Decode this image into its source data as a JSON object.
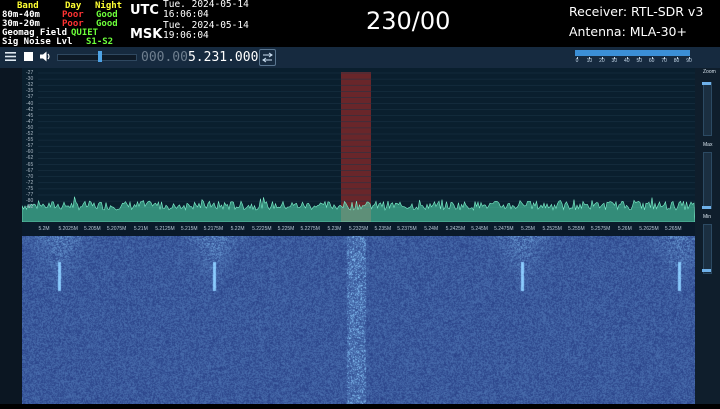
{
  "band_conditions": {
    "header": {
      "band": "Band",
      "day": "Day",
      "night": "Night"
    },
    "rows": [
      {
        "band": "80m-40m",
        "day": "Poor",
        "night": "Good"
      },
      {
        "band": "30m-20m",
        "day": "Poor",
        "night": "Good"
      }
    ],
    "geomag_label": "Geomag Field",
    "geomag_value": "QUIET",
    "noise_label": "Sig Noise Lvl",
    "noise_value": "S1-S2"
  },
  "clocks": [
    {
      "zone": "UTC",
      "date": "Tue. 2024-05-14",
      "time": "16:06:04"
    },
    {
      "zone": "MSK",
      "date": "Tue. 2024-05-14",
      "time": "19:06:04"
    }
  ],
  "big_frequency": "230/00",
  "receiver": {
    "label": "Receiver: RTL-SDR v3",
    "antenna": "Antenna: MLA-30+"
  },
  "toolbar": {
    "frequency_dim": "000.00",
    "frequency_value": "5.231.000",
    "swap_icon": "swap-arrows-icon",
    "zoom_scale": [
      "0",
      "10",
      "20",
      "30",
      "40",
      "50",
      "60",
      "70",
      "80",
      "90"
    ]
  },
  "spectrum": {
    "db_labels": [
      "-27",
      "-30",
      "-32",
      "-35",
      "-37",
      "-40",
      "-42",
      "-45",
      "-47",
      "-50",
      "-52",
      "-55",
      "-57",
      "-60",
      "-62",
      "-65",
      "-67",
      "-70",
      "-72",
      "-75",
      "-77",
      "-80",
      "-82"
    ],
    "freq_labels": [
      "5.2M",
      "5.2025M",
      "5.205M",
      "5.2075M",
      "5.21M",
      "5.2125M",
      "5.215M",
      "5.2175M",
      "5.22M",
      "5.2225M",
      "5.225M",
      "5.2275M",
      "5.23M",
      "5.2325M",
      "5.235M",
      "5.2375M",
      "5.24M",
      "5.2425M",
      "5.245M",
      "5.2475M",
      "5.25M",
      "5.2525M",
      "5.255M",
      "5.2575M",
      "5.26M",
      "5.2625M",
      "5.265M"
    ]
  },
  "right_panel": {
    "zoom": "Zoom",
    "max": "Max",
    "min": "Min"
  },
  "colors": {
    "accent": "#4ea3e6",
    "good": "#6cff3a",
    "poor": "#ff3333",
    "yellow": "#ffff33",
    "spectrum": "#56e6b8"
  }
}
